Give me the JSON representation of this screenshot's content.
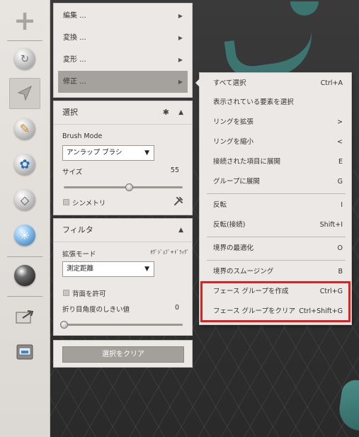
{
  "colors": {
    "highlight": "#e02020",
    "panel_bg": "#ebe8e5",
    "viewport_mesh": "#3d7b77"
  },
  "toolbar": {
    "tools": [
      {
        "name": "add-icon"
      },
      {
        "name": "meshmix-icon"
      },
      {
        "name": "select-icon"
      },
      {
        "name": "sculpt-icon"
      },
      {
        "name": "stamp-icon"
      },
      {
        "name": "edit-icon"
      },
      {
        "name": "analysis-icon"
      },
      {
        "name": "shaders-icon"
      },
      {
        "name": "export-icon"
      },
      {
        "name": "print-icon"
      }
    ]
  },
  "menu": {
    "items": [
      {
        "label": "編集 ...",
        "arrow": "▶"
      },
      {
        "label": "変換 ...",
        "arrow": "▶"
      },
      {
        "label": "変形 ...",
        "arrow": "▶"
      },
      {
        "label": "修正 ...",
        "arrow": "▶"
      }
    ]
  },
  "select_panel": {
    "title": "選択",
    "gear": "✱",
    "collapse": "▲",
    "brush_mode_label": "Brush Mode",
    "brush_mode_value": "アンラップ ブラシ",
    "size_label": "サイズ",
    "size_value": "55",
    "size_level": 0.55,
    "symmetry_label": "シンメトリ"
  },
  "filter_panel": {
    "title": "フィルタ",
    "collapse": "▲",
    "expand_mode_label": "拡張モード",
    "expand_mode_hint": "ｵｸﾞｼﾞｮﾌﾞ+ﾄﾞﾗｯｸﾞ",
    "expand_mode_value": "測定距離",
    "allow_back_label": "背面を許可",
    "fold_angle_label": "折り目角度のしきい値",
    "fold_angle_value": "0",
    "fold_angle_level": 0
  },
  "clear_button": {
    "label": "選択をクリア"
  },
  "submenu": {
    "items": [
      {
        "label": "すべて選択",
        "shortcut": "Ctrl+A"
      },
      {
        "label": "表示されている要素を選択",
        "shortcut": ""
      },
      {
        "label": "リングを拡張",
        "shortcut": ">"
      },
      {
        "label": "リングを縮小",
        "shortcut": "<"
      },
      {
        "label": "接続された項目に展開",
        "shortcut": "E"
      },
      {
        "label": "グループに展開",
        "shortcut": "G"
      },
      {
        "label": "反転",
        "shortcut": "I"
      },
      {
        "label": "反転(接続)",
        "shortcut": "Shift+I"
      },
      {
        "label": "境界の最適化",
        "shortcut": "O"
      },
      {
        "label": "境界のスムージング",
        "shortcut": "B"
      },
      {
        "label": "フェース グループを作成",
        "shortcut": "Ctrl+G"
      },
      {
        "label": "フェース グループをクリア",
        "shortcut": "Ctrl+Shift+G"
      }
    ]
  }
}
